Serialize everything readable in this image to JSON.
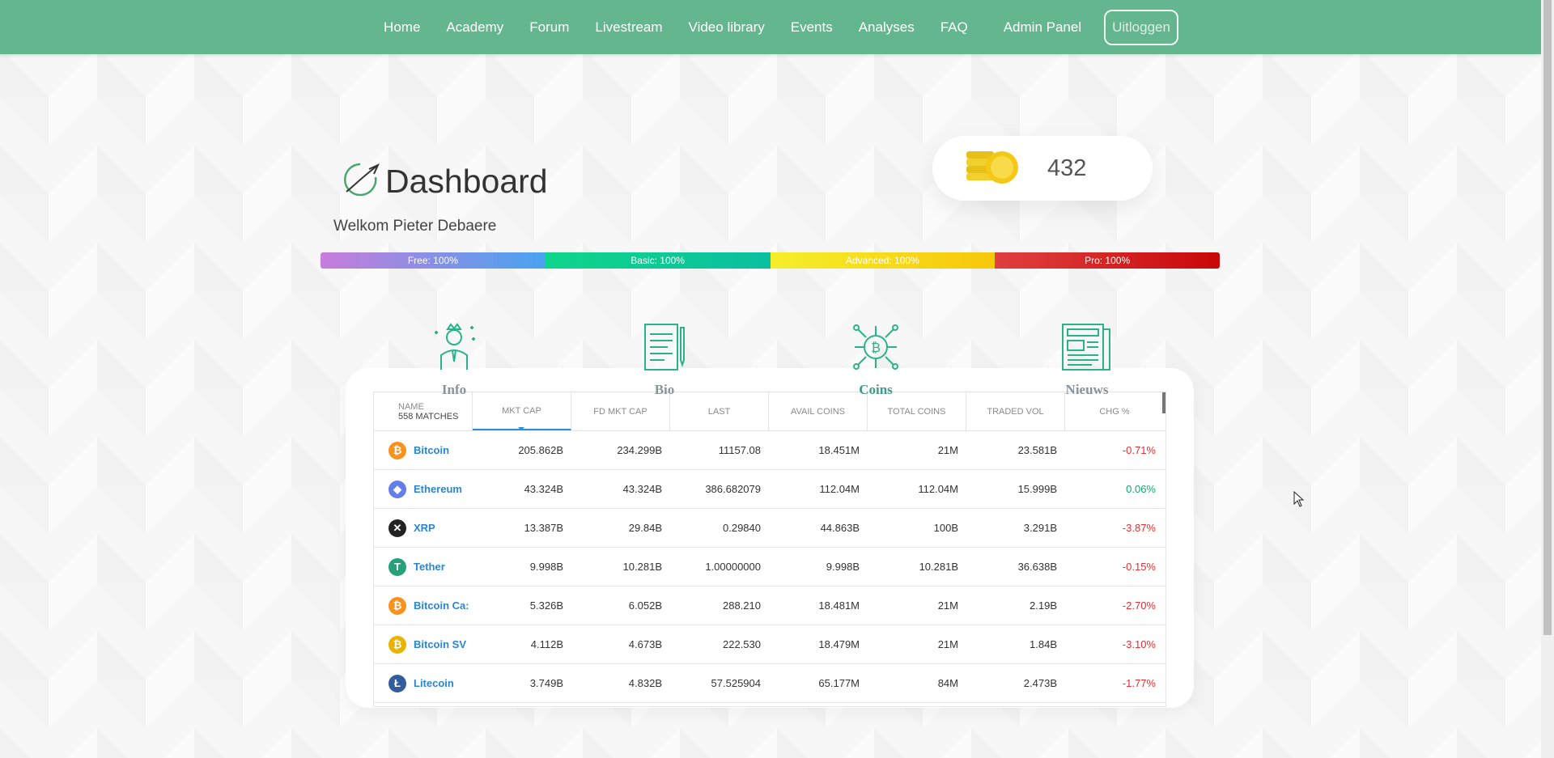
{
  "nav": {
    "items": [
      "Home",
      "Academy",
      "Forum",
      "Livestream",
      "Video library",
      "Events",
      "Analyses",
      "FAQ"
    ],
    "admin": "Admin Panel",
    "logout": "Uitloggen",
    "bg_color": "#63b68d"
  },
  "dashboard": {
    "title": "Dashboard",
    "welcome": "Welkom Pieter Debaere",
    "coins": "432"
  },
  "progress": {
    "free": "Free: 100%",
    "basic": "Basic: 100%",
    "advanced": "Advanced: 100%",
    "pro": "Pro: 100%"
  },
  "tabs": {
    "info": "Info",
    "bio": "Bio",
    "coins": "Coins",
    "news": "Nieuws"
  },
  "table": {
    "name_header": "NAME",
    "matches": "558 MATCHES",
    "headers": [
      "MKT CAP",
      "FD MKT CAP",
      "LAST",
      "AVAIL COINS",
      "TOTAL COINS",
      "TRADED VOL",
      "CHG %"
    ],
    "rows": [
      {
        "name": "Bitcoin",
        "icon": "bitcoin-icon",
        "color": "#f7931a",
        "glyph": "₿",
        "cells": [
          "205.862B",
          "234.299B",
          "11157.08",
          "18.451M",
          "21M",
          "23.581B"
        ],
        "chg": "-0.71%",
        "dir": "neg"
      },
      {
        "name": "Ethereum",
        "icon": "ethereum-icon",
        "color": "#627eea",
        "glyph": "◆",
        "cells": [
          "43.324B",
          "43.324B",
          "386.682079",
          "112.04M",
          "112.04M",
          "15.999B"
        ],
        "chg": "0.06%",
        "dir": "pos"
      },
      {
        "name": "XRP",
        "icon": "xrp-icon",
        "color": "#222222",
        "glyph": "✕",
        "cells": [
          "13.387B",
          "29.84B",
          "0.29840",
          "44.863B",
          "100B",
          "3.291B"
        ],
        "chg": "-3.87%",
        "dir": "neg"
      },
      {
        "name": "Tether",
        "icon": "tether-icon",
        "color": "#26a17b",
        "glyph": "T",
        "cells": [
          "9.998B",
          "10.281B",
          "1.00000000",
          "9.998B",
          "10.281B",
          "36.638B"
        ],
        "chg": "-0.15%",
        "dir": "neg"
      },
      {
        "name": "Bitcoin Ca:",
        "icon": "bitcoin-cash-icon",
        "color": "#f7931a",
        "glyph": "₿",
        "cells": [
          "5.326B",
          "6.052B",
          "288.210",
          "18.481M",
          "21M",
          "2.19B"
        ],
        "chg": "-2.70%",
        "dir": "neg"
      },
      {
        "name": "Bitcoin SV",
        "icon": "bitcoin-sv-icon",
        "color": "#eab300",
        "glyph": "₿",
        "cells": [
          "4.112B",
          "4.673B",
          "222.530",
          "18.479M",
          "21M",
          "1.84B"
        ],
        "chg": "-3.10%",
        "dir": "neg"
      },
      {
        "name": "Litecoin",
        "icon": "litecoin-icon",
        "color": "#345d9d",
        "glyph": "Ł",
        "cells": [
          "3.749B",
          "4.832B",
          "57.525904",
          "65.177M",
          "84M",
          "2.473B"
        ],
        "chg": "-1.77%",
        "dir": "neg"
      }
    ]
  }
}
